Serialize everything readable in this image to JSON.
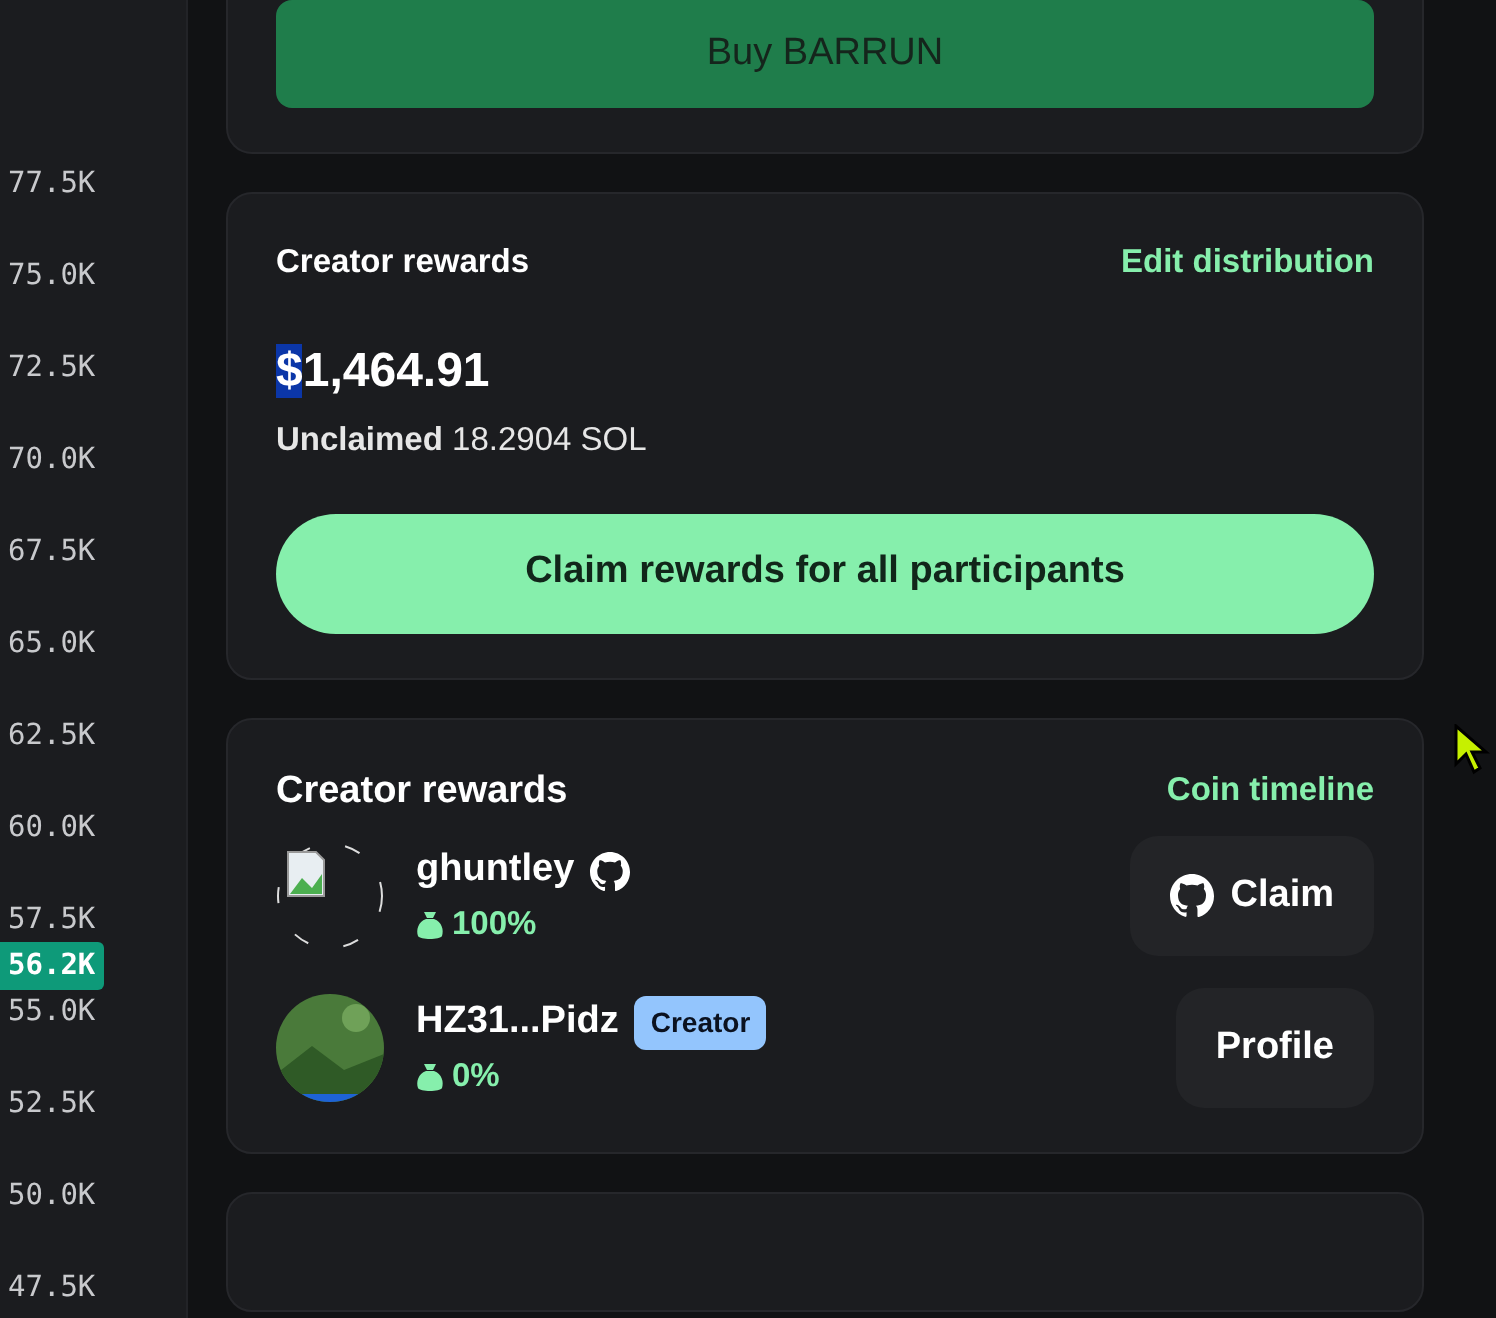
{
  "price_axis": {
    "labels": [
      "77.5K",
      "75.0K",
      "72.5K",
      "70.0K",
      "67.5K",
      "65.0K",
      "62.5K",
      "60.0K",
      "57.5K",
      "55.0K",
      "52.5K",
      "50.0K",
      "47.5K"
    ],
    "current_price": "56.2K"
  },
  "buy_card": {
    "button": "Buy BARRUN"
  },
  "rewards_card": {
    "title": "Creator rewards",
    "link": "Edit distribution",
    "amount_parts": [
      {
        "text": "$",
        "selected": true
      },
      {
        "text": "1,464.91",
        "selected": false
      }
    ],
    "unclaimed_label": "Unclaimed",
    "unclaimed_value": "18.2904 SOL",
    "button": "Claim rewards for all participants"
  },
  "participants_card": {
    "title": "Creator rewards",
    "link": "Coin timeline",
    "participants": [
      {
        "name": "ghuntley",
        "avatar": {
          "kind": "broken"
        },
        "github": true,
        "share": "100%",
        "action": {
          "label": "Claim",
          "github": true
        }
      },
      {
        "name": "HZ31...Pidz",
        "github": false,
        "badge": "Creator",
        "share": "0%",
        "action": {
          "label": "Profile",
          "github": false
        }
      }
    ]
  }
}
